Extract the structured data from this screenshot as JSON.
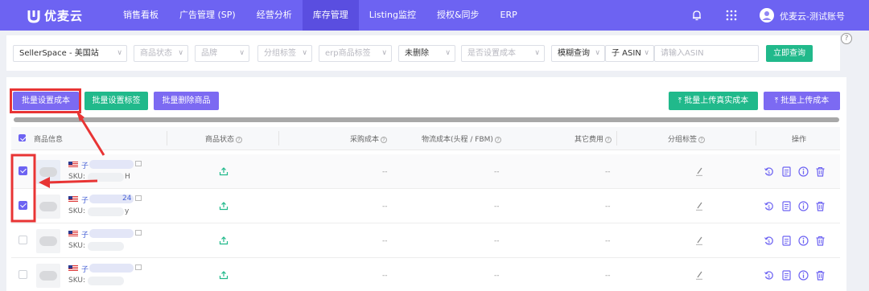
{
  "app": {
    "name": "优麦云",
    "user": "优麦云-测试账号"
  },
  "nav": [
    "销售看板",
    "广告管理 (SP)",
    "经营分析",
    "库存管理",
    "Listing监控",
    "授权&同步",
    "ERP"
  ],
  "nav_active": "库存管理",
  "filters": {
    "shop": "SellerSpace - 美国站",
    "product_status": "商品状态",
    "brand": "品牌",
    "group_tag": "分组标签",
    "erp_tag": "erp商品标签",
    "deleted": "未删除",
    "cost_set": "是否设置成本",
    "match_mode": "模糊查询",
    "field": "子 ASIN",
    "search_placeholder": "请输入ASIN",
    "query_button": "立即查询"
  },
  "toolbar": {
    "batch_cost": "批量设置成本",
    "batch_tag": "批量设置标签",
    "batch_delete": "批量删除商品",
    "upload_real_cost": "批量上传真实成本",
    "upload_cost": "批量上传成本"
  },
  "table": {
    "headers": {
      "product_info": "商品信息",
      "status": "商品状态",
      "purchase_cost": "采购成本",
      "logistics_cost": "物流成本(头程 / FBM)",
      "other_fee": "其它费用",
      "group_tag": "分组标签",
      "actions": "操作"
    },
    "rows": [
      {
        "checked": true,
        "asin_prefix": "子",
        "sku_prefix": "SKU:",
        "sku_tail": "H",
        "asin_tail": "",
        "purchase_cost": "--",
        "logistics_cost": "--",
        "other_fee": "--"
      },
      {
        "checked": true,
        "asin_prefix": "子",
        "sku_prefix": "SKU:",
        "sku_tail": "y",
        "asin_tail": "24",
        "purchase_cost": "--",
        "logistics_cost": "--",
        "other_fee": "--"
      },
      {
        "checked": false,
        "asin_prefix": "子",
        "sku_prefix": "SKU:",
        "sku_tail": "",
        "asin_tail": "",
        "purchase_cost": "--",
        "logistics_cost": "--",
        "other_fee": "--"
      },
      {
        "checked": false,
        "asin_prefix": "子",
        "sku_prefix": "SKU:",
        "sku_tail": "",
        "asin_tail": "",
        "purchase_cost": "--",
        "logistics_cost": "--",
        "other_fee": "--"
      }
    ]
  },
  "colors": {
    "brand": "#6d63f2",
    "nav_active": "#5a4ee0",
    "green": "#21b98b",
    "highlight": "#e83434"
  },
  "help_glyph": "?"
}
